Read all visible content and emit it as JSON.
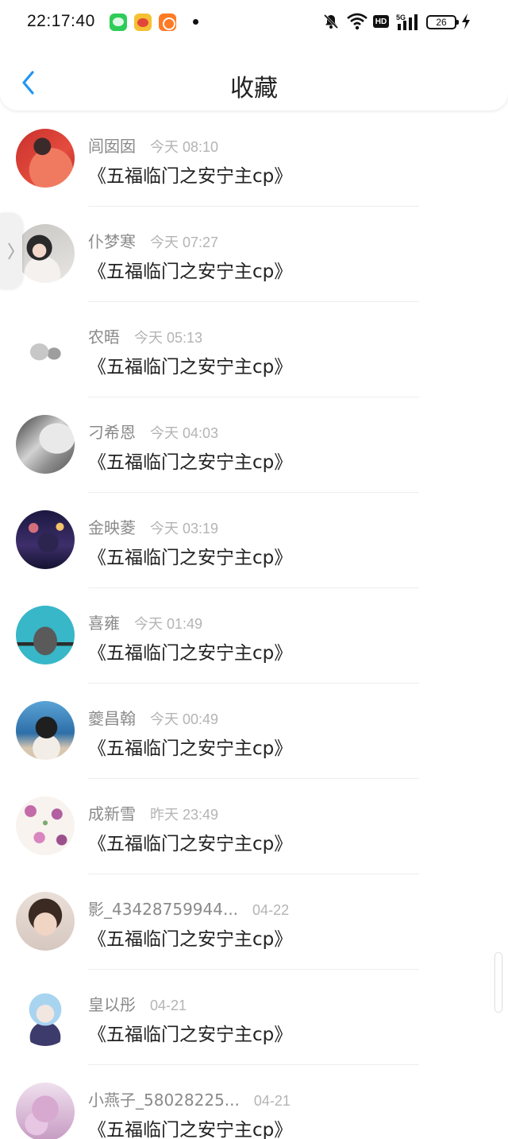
{
  "status_bar": {
    "time": "22:17:40",
    "battery": "26",
    "hd_label": "HD",
    "signal_label": "5G",
    "apps": [
      "wechat-icon",
      "weibo-icon",
      "kuaishou-icon"
    ]
  },
  "header": {
    "title": "收藏",
    "back_icon": "chevron-left-icon"
  },
  "colors": {
    "accent": "#2196F3",
    "name": "#8a8a8a",
    "time": "#b4b4b4",
    "title": "#222222"
  },
  "favorites": [
    {
      "name": "闾囡囡",
      "time": "今天 08:10",
      "title": "《五福临门之安宁主cp》"
    },
    {
      "name": "仆梦寒",
      "time": "今天 07:27",
      "title": "《五福临门之安宁主cp》"
    },
    {
      "name": "农晤",
      "time": "今天 05:13",
      "title": "《五福临门之安宁主cp》"
    },
    {
      "name": "刁希恩",
      "time": "今天 04:03",
      "title": "《五福临门之安宁主cp》"
    },
    {
      "name": "金映菱",
      "time": "今天 03:19",
      "title": "《五福临门之安宁主cp》"
    },
    {
      "name": "喜雍",
      "time": "今天 01:49",
      "title": "《五福临门之安宁主cp》"
    },
    {
      "name": "夔昌翰",
      "time": "今天 00:49",
      "title": "《五福临门之安宁主cp》"
    },
    {
      "name": "成新雪",
      "time": "昨天 23:49",
      "title": "《五福临门之安宁主cp》"
    },
    {
      "name": "影_43428759944...",
      "time": "04-22",
      "title": "《五福临门之安宁主cp》"
    },
    {
      "name": "皇以彤",
      "time": "04-21",
      "title": "《五福临门之安宁主cp》"
    },
    {
      "name": "小燕子_58028225...",
      "time": "04-21",
      "title": "《五福临门之安宁主cp》"
    }
  ]
}
